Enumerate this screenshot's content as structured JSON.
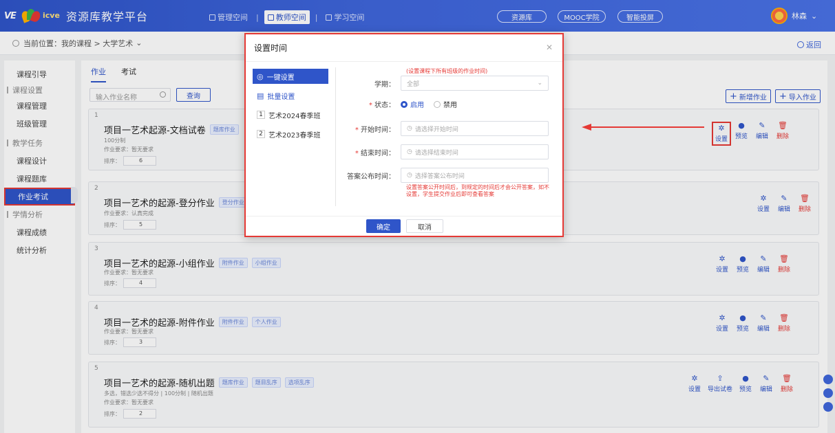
{
  "app": {
    "logo_ve": "VE",
    "logo_icve": "icve",
    "brand": "资源库教学平台",
    "nav": [
      {
        "label": "管理空间"
      },
      {
        "label": "教师空间"
      },
      {
        "label": "学习空间"
      }
    ],
    "pills": [
      "资源库",
      "MOOC学院",
      "智能投屏"
    ],
    "user": "林森"
  },
  "breadcrumb": {
    "text": "当前位置：我的课程 > 大学艺术",
    "back": "返回"
  },
  "sidebar": {
    "items": [
      {
        "label": "课程引导"
      },
      {
        "label": "课程设置"
      },
      {
        "label": "课程管理"
      },
      {
        "label": "班级管理"
      },
      {
        "label": "教学任务"
      },
      {
        "label": "课程设计"
      },
      {
        "label": "课程题库"
      },
      {
        "label": "作业考试"
      },
      {
        "label": "学情分析"
      },
      {
        "label": "课程成绩"
      },
      {
        "label": "统计分析"
      }
    ]
  },
  "main": {
    "tabs": [
      {
        "label": "作业"
      },
      {
        "label": "考试"
      }
    ],
    "search_placeholder": "输入作业名称",
    "query": "查询",
    "add": "新增作业",
    "import": "导入作业",
    "cards": [
      {
        "num": "1",
        "title": "项目一艺术起源-文档试卷",
        "tags": [
          "题库作业"
        ],
        "lines": [
          "100分制",
          "作业要求：暂无要求"
        ],
        "sort_label": "排序：",
        "sort": "6"
      },
      {
        "num": "2",
        "title": "项目一艺术的起源-登分作业",
        "tags": [
          "登分作业"
        ],
        "lines": [
          "作业要求：认真完成"
        ],
        "sort_label": "排序：",
        "sort": "5"
      },
      {
        "num": "3",
        "title": "项目一艺术的起源-小组作业",
        "tags": [
          "附件作业",
          "小组作业"
        ],
        "lines": [
          "作业要求：暂无要求"
        ],
        "sort_label": "排序：",
        "sort": "4"
      },
      {
        "num": "4",
        "title": "项目一艺术的起源-附件作业",
        "tags": [
          "附件作业",
          "个人作业"
        ],
        "lines": [
          "作业要求：暂无要求"
        ],
        "sort_label": "排序：",
        "sort": "3"
      },
      {
        "num": "5",
        "title": "项目一艺术的起源-随机出题",
        "tags": [
          "题库作业",
          "题目乱序",
          "选项乱序"
        ],
        "lines": [
          "多选，错选少选不得分 | 100分制 | 随机出题",
          "作业要求：暂无要求"
        ],
        "sort_label": "排序：",
        "sort": "2"
      }
    ],
    "actions": {
      "settings": "设置",
      "preview": "预览",
      "edit": "编辑",
      "delete": "删除",
      "export": "导出试卷"
    }
  },
  "modal": {
    "title": "设置时间",
    "left": [
      {
        "label": "一键设置"
      },
      {
        "label": "批量设置"
      },
      {
        "num": "1",
        "label": "艺术2024春季班"
      },
      {
        "num": "2",
        "label": "艺术2023春季班"
      }
    ],
    "hint_top": "(设置课程下所有班级的作业时间)",
    "term_label": "学期：",
    "term_value": "全部",
    "status_label": "状态：",
    "status_on": "启用",
    "status_off": "禁用",
    "start_label": "开始时间：",
    "start_placeholder": "请选择开始时间",
    "end_label": "结束时间：",
    "end_placeholder": "请选择结束时间",
    "answer_label": "答案公布时间：",
    "answer_placeholder": "选择答案公布时间",
    "answer_hint": "设置答案公开时间后，到规定的时间后才会公开答案，如不设置，学生提交作业后即可查看答案",
    "ok": "确定",
    "cancel": "取消"
  },
  "colors": {
    "primary": "#2f55c9",
    "highlight": "#e53935"
  }
}
